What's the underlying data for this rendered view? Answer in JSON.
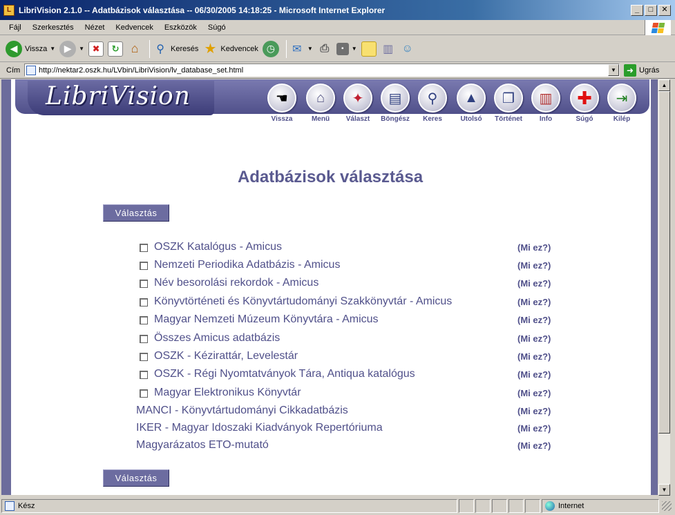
{
  "window": {
    "title": "LibriVision 2.1.0 -- Adatbázisok választása -- 06/30/2005 14:18:25 - Microsoft Internet Explorer",
    "minimize": "_",
    "maximize": "□",
    "close": "✕"
  },
  "menu": [
    "Fájl",
    "Szerkesztés",
    "Nézet",
    "Kedvencek",
    "Eszközök",
    "Súgó"
  ],
  "toolbar": {
    "back_label": "Vissza",
    "search_label": "Keresés",
    "favorites_label": "Kedvencek"
  },
  "address": {
    "label": "Cím",
    "url": "http://nektar2.oszk.hu/LVbin/LibriVision/lv_database_set.html",
    "go_label": "Ugrás"
  },
  "banner": {
    "logo": "LibriVision",
    "nav": [
      {
        "label": "Vissza",
        "icon": "pointing-hand-icon"
      },
      {
        "label": "Menü",
        "icon": "house-icon"
      },
      {
        "label": "Választ",
        "icon": "compass-star-icon"
      },
      {
        "label": "Böngész",
        "icon": "book-stack-icon"
      },
      {
        "label": "Keres",
        "icon": "magnifier-icon"
      },
      {
        "label": "Utolsó",
        "icon": "last-icon"
      },
      {
        "label": "Történet",
        "icon": "history-icon"
      },
      {
        "label": "Info",
        "icon": "books-icon"
      },
      {
        "label": "Súgó",
        "icon": "red-cross-icon"
      },
      {
        "label": "Kilép",
        "icon": "exit-door-icon"
      }
    ]
  },
  "page": {
    "heading": "Adatbázisok választása",
    "select_button": "Választás",
    "databases": [
      {
        "name": "OSZK Katalógus - Amicus",
        "checkbox": true,
        "info": "(Mi ez?)"
      },
      {
        "name": "Nemzeti Periodika Adatbázis - Amicus",
        "checkbox": true,
        "info": "(Mi ez?)"
      },
      {
        "name": "Név besorolási rekordok - Amicus",
        "checkbox": true,
        "info": "(Mi ez?)"
      },
      {
        "name": "Könyvtörténeti és Könyvtártudományi Szakkönyvtár - Amicus",
        "checkbox": true,
        "info": "(Mi ez?)"
      },
      {
        "name": "Magyar Nemzeti Múzeum Könyvtára - Amicus",
        "checkbox": true,
        "info": "(Mi ez?)"
      },
      {
        "name": "Összes Amicus adatbázis",
        "checkbox": true,
        "info": "(Mi ez?)"
      },
      {
        "name": "OSZK - Kézirattár, Levelestár",
        "checkbox": true,
        "info": "(Mi ez?)"
      },
      {
        "name": "OSZK - Régi Nyomtatványok Tára, Antiqua katalógus",
        "checkbox": true,
        "info": "(Mi ez?)"
      },
      {
        "name": "Magyar Elektronikus Könyvtár",
        "checkbox": true,
        "info": "(Mi ez?)"
      },
      {
        "name": "MANCI - Könyvtártudományi Cikkadatbázis",
        "checkbox": false,
        "info": "(Mi ez?)"
      },
      {
        "name": "IKER - Magyar Idoszaki Kiadványok Repertóriuma",
        "checkbox": false,
        "info": "(Mi ez?)"
      },
      {
        "name": "Magyarázatos ETO-mutató",
        "checkbox": false,
        "info": "(Mi ez?)"
      }
    ]
  },
  "status": {
    "text": "Kész",
    "zone": "Internet"
  },
  "colors": {
    "brand": "#5a5a90",
    "button": "#6c6ca0",
    "titlebar": "#0a246a"
  }
}
